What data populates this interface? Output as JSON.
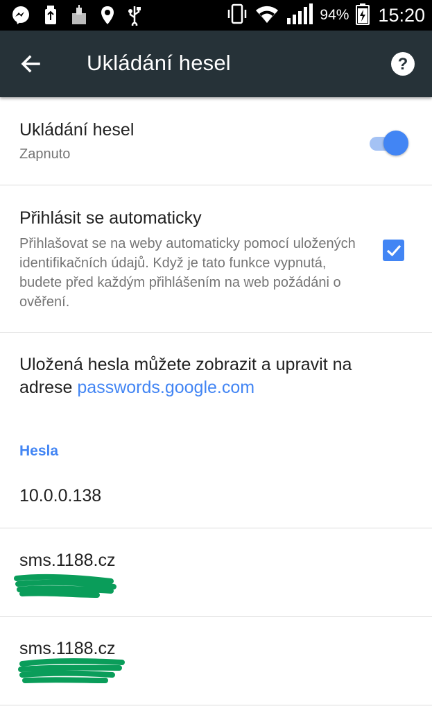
{
  "status_bar": {
    "icons": [
      "messenger-icon",
      "usb-storage-icon",
      "app-icon",
      "location-icon",
      "usb-icon"
    ],
    "right_icons": [
      "vibrate-icon",
      "wifi-icon",
      "signal-icon",
      "battery-charging-icon"
    ],
    "battery_percent": "94%",
    "time": "15:20"
  },
  "toolbar": {
    "title": "Ukládání hesel"
  },
  "save_passwords": {
    "title": "Ukládání hesel",
    "status": "Zapnuto",
    "enabled": true
  },
  "auto_signin": {
    "title": "Přihlásit se automaticky",
    "description": "Přihlašovat se na weby automaticky pomocí uložených identifikačních údajů. Když je tato funkce vypnutá, budete před každým přihlášením na web požádáni o ověření.",
    "checked": true
  },
  "info": {
    "text": "Uložená hesla můžete zobrazit a upravit na adrese ",
    "link": "passwords.google.com"
  },
  "passwords_section": {
    "header": "Hesla",
    "items": [
      {
        "site": "10.0.0.138"
      },
      {
        "site": "sms.1188.cz"
      },
      {
        "site": "sms.1188.cz"
      }
    ]
  },
  "colors": {
    "toolbar": "#263238",
    "accent": "#4285f4",
    "redaction": "#0a9d5a"
  }
}
